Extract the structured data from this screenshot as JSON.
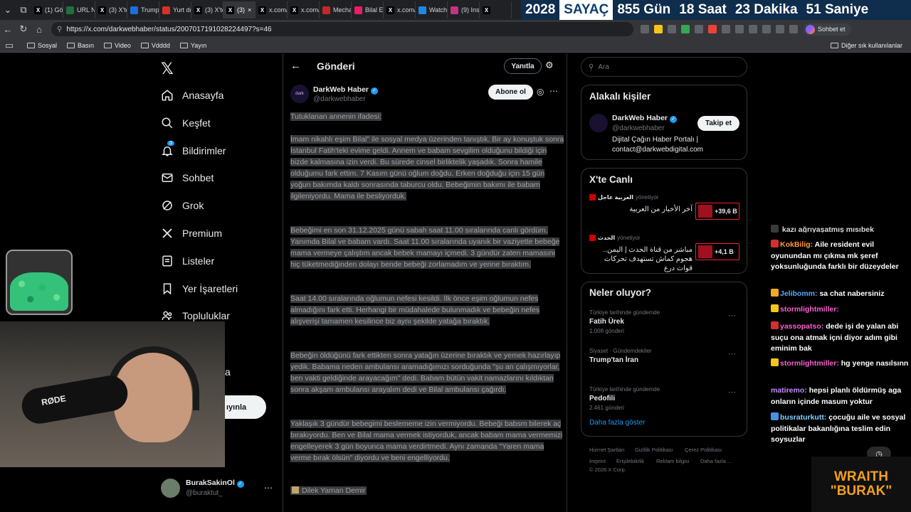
{
  "browser": {
    "tabs": [
      {
        "label": "(1) Gö",
        "icon": "x-logo-icon",
        "color": "#000000"
      },
      {
        "label": "URL N",
        "icon": "link-icon",
        "color": "#1f6f3f"
      },
      {
        "label": "(3) X'te",
        "icon": "x-logo-icon",
        "color": "#000000"
      },
      {
        "label": "Trump",
        "icon": "news-icon",
        "color": "#1d6fd8"
      },
      {
        "label": "Yurt dı",
        "icon": "news-icon",
        "color": "#d93025"
      },
      {
        "label": "(3) X'te",
        "icon": "x-logo-icon",
        "color": "#000000"
      },
      {
        "label": "(3)",
        "icon": "x-logo-icon",
        "color": "#000000",
        "active": true
      },
      {
        "label": "x.com/",
        "icon": "x-logo-icon",
        "color": "#000000"
      },
      {
        "label": "x.com/",
        "icon": "x-logo-icon",
        "color": "#000000"
      },
      {
        "label": "Mecha",
        "icon": "game-icon",
        "color": "#c62828"
      },
      {
        "label": "Bilal Er",
        "icon": "video-icon",
        "color": "#e91e63"
      },
      {
        "label": "x.com/",
        "icon": "x-logo-icon",
        "color": "#000000"
      },
      {
        "label": "Watch",
        "icon": "watch-icon",
        "color": "#1e88e5"
      },
      {
        "label": "(9) Inst",
        "icon": "instagram-icon",
        "color": "#c13584"
      },
      {
        "label": "",
        "icon": "x-logo-icon",
        "color": "#000000"
      }
    ],
    "url": "https://x.com/darkwebhaber/status/2007017191028224497?s=46",
    "profile_label": "Sohbet et",
    "bookmarks": [
      "Sosyal",
      "Basın",
      "Video",
      "Vdddd",
      "Yayın"
    ],
    "other_bookmarks": "Diğer sık kullanılanlar"
  },
  "counter": {
    "year": "2028",
    "label": "SAYAÇ",
    "days": "855 Gün",
    "hours": "18 Saat",
    "minutes": "23 Dakika",
    "seconds": "51 Saniye"
  },
  "nav": {
    "items": [
      {
        "label": "Anasayfa",
        "icon": "home-icon"
      },
      {
        "label": "Keşfet",
        "icon": "search-icon"
      },
      {
        "label": "Bildirimler",
        "icon": "bell-icon",
        "badge": "3"
      },
      {
        "label": "Sohbet",
        "icon": "mail-icon"
      },
      {
        "label": "Grok",
        "icon": "grok-icon"
      },
      {
        "label": "Premium",
        "icon": "x-logo-icon"
      },
      {
        "label": "Listeler",
        "icon": "list-icon"
      },
      {
        "label": "Yer İşaretleri",
        "icon": "bookmark-icon"
      },
      {
        "label": "Topluluklar",
        "icon": "people-icon"
      }
    ],
    "partial_item": "a",
    "post_button_partial": "ıyınla",
    "account": {
      "name": "BurakSakinOl",
      "handle": "@buraktut_"
    }
  },
  "post": {
    "header": "Gönderi",
    "reply_button": "Yanıtla",
    "author": "DarkWeb Haber",
    "handle": "@darkwebhaber",
    "avatar_text": "dark",
    "subscribe": "Abone ol",
    "paragraphs": [
      "Tutuklanan annenin ifadesi:",
      "İmam nikahlı eşim Bilal\" ile sosyal medya üzerinden tanıştık. Bir ay konuştuk sonra İstanbul Fatih'teki evime geldi. Annem ve babam sevgilim olduğunu bildiği için bizde kalmasına izin verdi. Bu sürede cinsel birliktelik yaşadık. Sonra hamile olduğumu fark ettim. 7 Kasım günü oğlum doğdu. Erken doğduğu için 15 gün yoğun bakımda kaldı sonrasında taburcu oldu. Bebeğimin bakımı ile babam ilgileniyordu. Mama ile besliyorduk.",
      "Bebeğimi en son 31.12.2025 günü sabah saat 11.00 sıralarında canlı gördüm. Yanımda Bilal ve babam vardı. Saat 11.00 sıralarında uyanık bir vaziyette bebeğe mama vermeye çalıştım ancak bebek mamayı içmedi. 3 gündür zaten mamasını hiç tüketmediğinden dolayı bende bebeği zorlamadım ve yerine bıraktım.",
      "Saat 14.00 sıralarında oğlumun nefesi kesildi. İlk önce eşim oğlumun nefes almadığını fark etti. Herhangi bir müdahalede bulunmadık ve bebeğin nefes alışverişi tamamen kesilince biz aynı şekilde yatağa bıraktık.",
      "Bebeğin öldüğünü fark ettikten sonra yatağın üzerine bıraktık ve yemek hazırlayıp yedik. Babama neden ambulansı aramadığımızı sorduğunda \"şu an çalışmıyorlar, ben vakti geldiğinde arayacağım\" dedi. Babam bütün vakit namazlarını kıldıktan sonra akşam ambulansı arayalım dedi ve Bilal ambulansı çağırdı.",
      "Yaklaşık 3 gündür bebegimi beslememe izin vermiyordu. Bebeği babsm bilerek aç bırakıyordu. Ben ve Bilal mama vermek istiyorduk, ancak babam mama vermemizi engelleyerek 3 gün boyunca mama verdirtmedi. Aynı zamanda \"Yaren mama verme bırak ölsün\" diyordu ve beni engelliyordu."
    ],
    "signature": "Dilek Yaman Demir"
  },
  "sidebar": {
    "search_placeholder": "Ara",
    "related": {
      "title": "Alakalı kişiler",
      "name": "DarkWeb Haber",
      "handle": "@darkwebhaber",
      "follow": "Takip et",
      "bio_line1": "Dijital Çağın Haber Portalı |",
      "bio_line2": "contact@darkwebdigital.com"
    },
    "live": {
      "title": "X'te Canlı",
      "items": [
        {
          "host": "العربية عاجل",
          "role": "yönetiyor",
          "text": "آخر الأخبار من العربية",
          "count": "+39,6 B"
        },
        {
          "host": "الحدث",
          "role": "yönetiyor",
          "text": "مباشر من قناة الحدث | اليمن.. هجوم كماش تستهدف تحركات قوات درع",
          "count": "+4,1 B"
        }
      ]
    },
    "trends": {
      "title": "Neler oluyor?",
      "items": [
        {
          "category": "Türkiye tarihinde gündemde",
          "topic": "Fatih Ürek",
          "posts": "1.008 gönderi"
        },
        {
          "category": "Siyaset · Gündemdekiler",
          "topic": "Trump'tan İran",
          "posts": ""
        },
        {
          "category": "Türkiye tarihinde gündemde",
          "topic": "Pedofili",
          "posts": "2.461 gönderi"
        }
      ],
      "more": "Daha fazla göster"
    },
    "footer": {
      "links1": [
        "Hizmet Şartları",
        "Gizlilik Politikası",
        "Çerez Politikası"
      ],
      "links2": [
        "Imprint",
        "Erişilebilirlik",
        "Reklam bilgisi",
        "Daha fazla ..."
      ],
      "copyright": "© 2026 X Corp."
    }
  },
  "stream": {
    "chat": [
      {
        "user": "",
        "msg": "kazı ağrıyaşatmış mısıbek",
        "color": "#ffffff",
        "badge": "#444"
      },
      {
        "user": "KokBilig:",
        "msg": "Aile resident evil oyunundan mı çıkma mk şeref yoksunluğunda farklı bir düzeydeler",
        "color": "#ff9a3c",
        "badge": "#d32f2f"
      },
      {
        "user": "Jelibomm:",
        "msg": "sa chat nabersiniz",
        "color": "#5aa9ff",
        "badge": "#f5a623"
      },
      {
        "user": "stormlightmiller:",
        "msg": "",
        "color": "#ff5fd2",
        "badge": "#f5c518"
      },
      {
        "user": "yassopatso:",
        "msg": "dede işi de yalan abi suçu ona atmak içni diyor adım gibi eminim bak",
        "color": "#ff5fd2",
        "badge": "#d32f2f"
      },
      {
        "user": "stormlightmiller:",
        "msg": "hg yenge nasılsınn",
        "color": "#ff5fd2",
        "badge": "#f5c518"
      },
      {
        "user": "matiremo:",
        "msg": "hepsi planlı öldürmüş aga onların içinde masum yoktur",
        "color": "#c08cff",
        "badge": ""
      },
      {
        "user": "busraturkutt:",
        "msg": "çocuğu aile ve sosyal politikalar bakanlığına teslim edin soysuzlar",
        "color": "#7fd1ff",
        "badge": "#4a90e2"
      }
    ],
    "mic_label": "RØDE",
    "logo_line1": "WRAITH",
    "logo_line2": "\"BURAK\"",
    "colors": {
      "logo": "#f2a01c",
      "accent": "#1d9bf0"
    }
  }
}
